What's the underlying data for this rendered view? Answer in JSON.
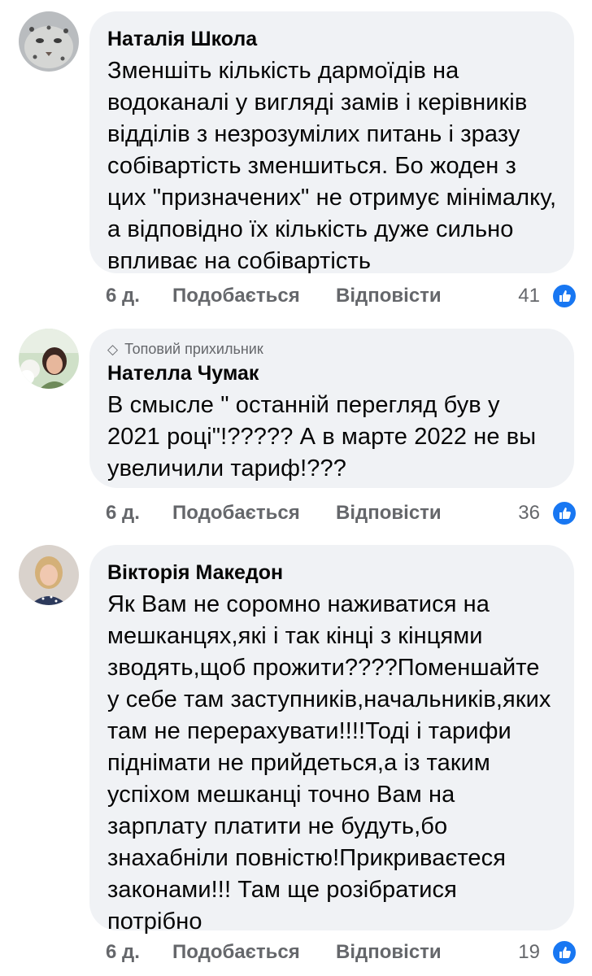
{
  "comments": [
    {
      "author": "Наталія Школа",
      "badge": "",
      "text": "Зменшіть кількість дармоїдів на водоканалі у вигляді замів і керівників відділів з незрозумілих питань і зразу собівартість зменшиться. Бо жоден з цих \"призначених\" не отримує мінімалку, а відповідно їх кількість дуже сильно впливає на собівартість",
      "time": "6 д.",
      "like_label": "Подобається",
      "reply_label": "Відповісти",
      "reactions": "41"
    },
    {
      "author": "Нателла Чумак",
      "badge": "Топовий прихильник",
      "text": "В смысле \" останній перегляд був у 2021 році\"!????? А в марте 2022 не вы увеличили тариф!???",
      "time": "6 д.",
      "like_label": "Подобається",
      "reply_label": "Відповісти",
      "reactions": "36"
    },
    {
      "author": "Вікторія Македон",
      "badge": "",
      "text": "Як Вам не соромно наживатися на мешканцях,які і так кінці з кінцями зводять,щоб прожити????Поменшайте у себе там заступників,начальників,яких там не перерахувати!!!!Тоді і тарифи піднімати не прийдеться,а із таким успіхом мешканці точно Вам на зарплату платити не будуть,бо знахабніли повністю!Прикриваєтеся законами!!! Там ще розібратися потрібно",
      "time": "6 д.",
      "like_label": "Подобається",
      "reply_label": "Відповісти",
      "reactions": "19"
    }
  ],
  "colors": {
    "bubble": "#f0f2f5",
    "secondary_text": "#65676b",
    "like_blue": "#1877f2"
  },
  "icons": {
    "reaction": "like-thumbs-up-icon",
    "badge": "diamond-icon"
  }
}
